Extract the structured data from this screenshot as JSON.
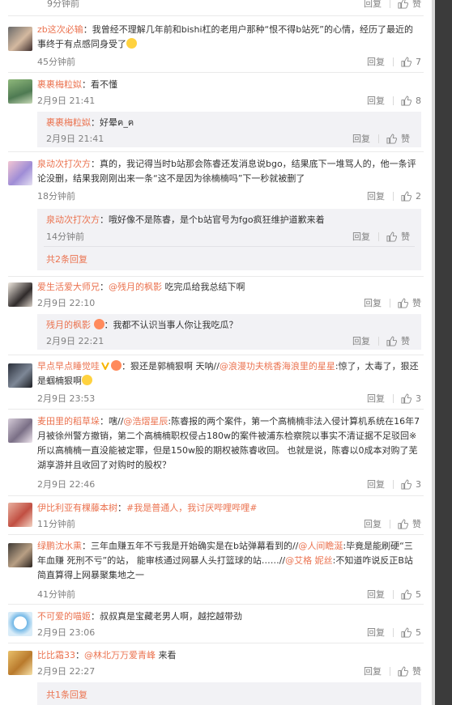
{
  "top_row": {
    "time": "9分钟前",
    "reply": "回复",
    "like": "赞"
  },
  "labels": {
    "reply": "回复",
    "like": "赞"
  },
  "comments": [
    {
      "user": "zb这次必输",
      "sep": "：",
      "body": "我曾经不理解几年前和bishi杠的老用户那种“恨不得b站死”的心情，经历了最近的事终于有点感同身受了",
      "time": "45分钟前",
      "likes": "7"
    },
    {
      "user": "裹裹梅粒姒",
      "sep": "：",
      "body": "看不懂",
      "time": "2月9日 21:41",
      "likes": "8",
      "replies": [
        {
          "user": "裹裹梅粒姒",
          "sep": "：",
          "body": "好晕ฅ_ฅ",
          "time": "2月9日 21:41",
          "likes": "赞"
        }
      ]
    },
    {
      "user": "泉动次打次方",
      "sep": "：",
      "body": "真的，我记得当时b站那会陈睿还发消息说bgo，结果底下一堆骂人的，他一条评论没删，结果我刚刚出来一条“这不是因为徐楠楠吗”下一秒就被删了",
      "time": "18分钟前",
      "likes": "2",
      "replies": [
        {
          "user": "泉动次打次方",
          "sep": "：",
          "body": "哦好像不是陈睿，是个b站官号为fgo疯狂维护道歉来着",
          "time": "14分钟前",
          "likes": "赞"
        }
      ],
      "more": "共2条回复"
    },
    {
      "user": "爱生活爱大师兄",
      "sep": "：",
      "mention": "@残月的枫影",
      "body": " 吃完瓜给我总结下啊",
      "time": "2月9日 22:10",
      "likes": "赞",
      "replies": [
        {
          "user": "残月的枫影",
          "sep": "：",
          "body": "我都不认识当事人你让我吃瓜？",
          "time": "2月9日 22:21",
          "likes": "赞"
        }
      ]
    },
    {
      "user": "早点早点睡觉哇",
      "sep": "：",
      "body": "狠还是郭楠狠啊 天呐//",
      "mention": "@浪漫功夫桃香海浪里的星星",
      "body2": ":惊了，太毒了，狠还是蝈楠狠啊",
      "time": "2月9日 23:53",
      "likes": "3"
    },
    {
      "user": "麦田里的稻草垛",
      "sep": "：",
      "body": "嗐//",
      "mention": "@浩熠星辰",
      "body2": ":陈睿报的两个案件，第一个高楠楠非法入侵计算机系统在16年7月被徐州警方撤销，第二个高楠楠职权侵占180w的案件被浦东检察院以事实不清证据不足驳回※所以高楠楠一直没能被定罪，但是150w股的期权被陈睿收回。 也就是说，陈睿以0成本对购了芜湖享游并且收回了对购时的股权？",
      "time": "2月9日 22:46",
      "likes": "3"
    },
    {
      "user": "伊比利亚有棵藤本树",
      "sep": "：",
      "body": "#我是普通人，我讨厌哔哩哔哩#",
      "time": "11分钟前",
      "likes": "赞"
    },
    {
      "user": "绿鹏沈水熏",
      "sep": "：",
      "body": "三年血赚五年不亏我是开始确实是在b站弹幕看到的//",
      "mention": "@人间瞻涎",
      "body2": ":毕竟是能刷硬“三年血赚 死刑不亏”的站， 能审核通过网暴人头打篮球的站……//",
      "mention2": "@艾格 妮丝",
      "body3": ":不知道咋说反正B站简直算得上网暴聚集地之一",
      "time": "41分钟前",
      "likes": "5"
    },
    {
      "user": "不可爱的喵姬",
      "sep": "：",
      "body": "叔叔真是宝藏老男人啊，越挖越带劲",
      "time": "2月9日 23:06",
      "likes": "5"
    },
    {
      "user": "比比霜33",
      "sep": "：",
      "mention": "@林北万万爱青峰",
      "body": " 来看",
      "time": "2月9日 22:27",
      "likes": "赞",
      "more": "共1条回复"
    }
  ],
  "colors": {
    "accent": "#eb7350",
    "meta": "#808080",
    "sub_bg": "#f2f2f5"
  }
}
